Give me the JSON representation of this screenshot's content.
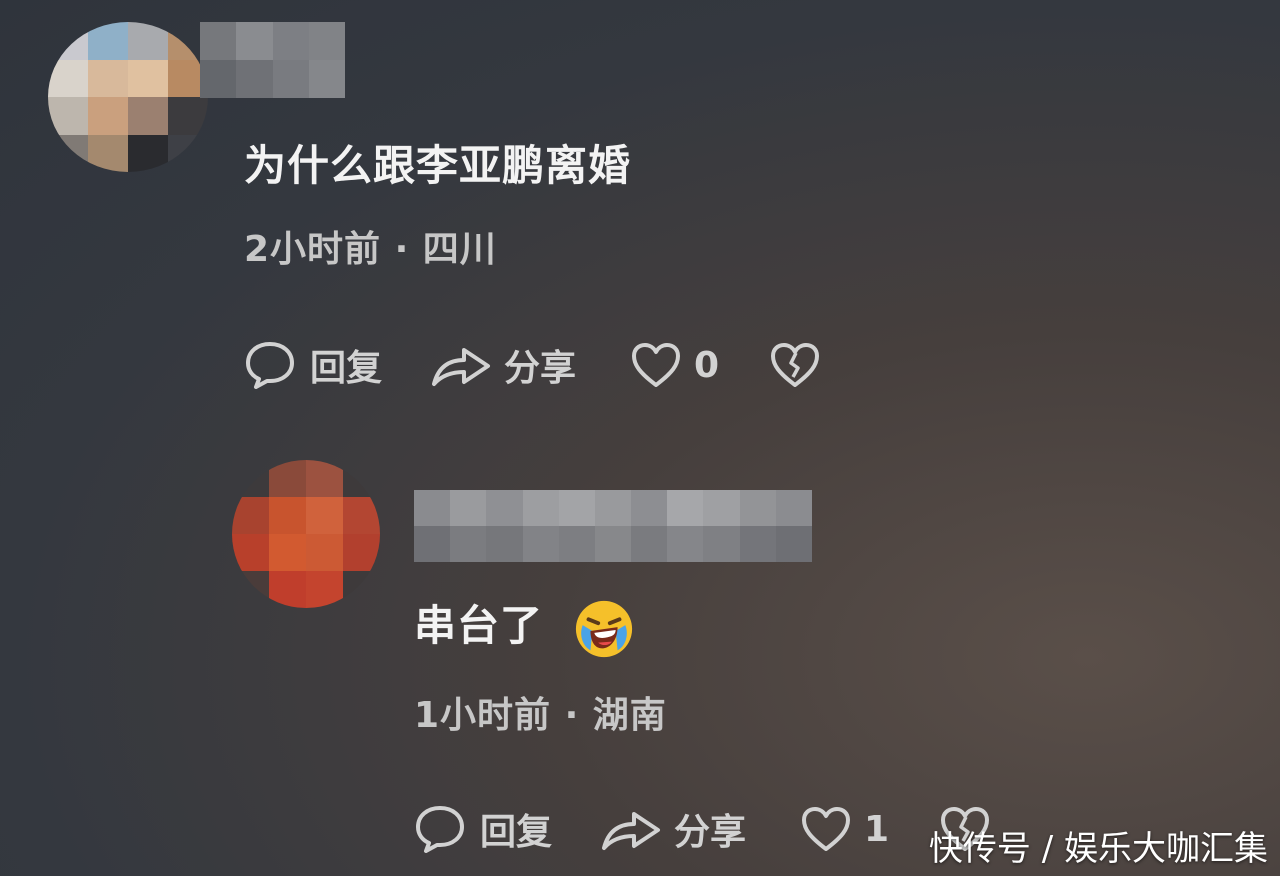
{
  "comments": [
    {
      "text": "为什么跟李亚鹏离婚",
      "time_location": "2小时前 · 四川",
      "reply_label": "回复",
      "share_label": "分享",
      "like_count": "0"
    },
    {
      "text": "串台了",
      "emoji": "laughing-crying-emoji",
      "time_location": "1小时前 · 湖南",
      "reply_label": "回复",
      "share_label": "分享",
      "like_count": "1"
    }
  ],
  "watermark": "快传号 / 娱乐大咖汇集",
  "colors": {
    "background": "#34383f",
    "text": "#f3f3f3",
    "meta": "#c7c7c7",
    "icon": "#d2d2d2"
  }
}
